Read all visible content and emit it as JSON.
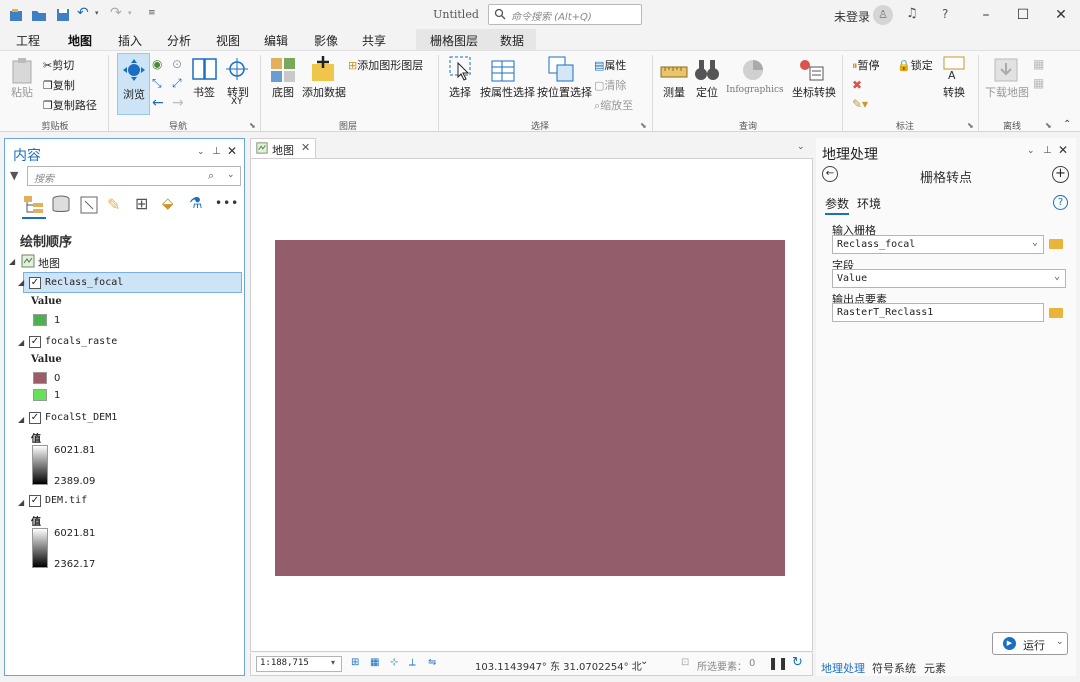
{
  "titlebar": {
    "doc_title": "Untitled",
    "search_placeholder": "命令搜索 (Alt+Q)",
    "signin": "未登录",
    "help": "?"
  },
  "tabs": [
    "工程",
    "地图",
    "插入",
    "分析",
    "视图",
    "编辑",
    "影像",
    "共享"
  ],
  "active_tab": "地图",
  "context_tabs": [
    "栅格图层",
    "数据"
  ],
  "ribbon": {
    "clipboard": {
      "paste": "粘贴",
      "cut": "剪切",
      "copy": "复制",
      "copy_path": "复制路径",
      "group": "剪贴板"
    },
    "navigate": {
      "explore": "浏览",
      "bookmarks": "书签",
      "goto": "转到",
      "goto_sub": "XY",
      "group": "导航"
    },
    "layer": {
      "basemap": "底图",
      "add_data": "添加数据",
      "add_graphics": "添加图形图层",
      "group": "图层"
    },
    "selection": {
      "select": "选择",
      "by_attr": "按属性选择",
      "by_location": "按位置选择",
      "attributes": "属性",
      "clear": "清除",
      "zoom_to": "缩放至",
      "group": "选择"
    },
    "inquiry": {
      "measure": "测量",
      "locate": "定位",
      "infographics": "Infographics",
      "coord_convert": "坐标转换",
      "group": "查询"
    },
    "labeling": {
      "pause": "暂停",
      "lock": "锁定",
      "convert": "转换",
      "group": "标注"
    },
    "offline": {
      "download_map": "下载地图",
      "group": "离线"
    }
  },
  "contents": {
    "title": "内容",
    "search_placeholder": "搜索",
    "drawing_order": "绘制顺序",
    "map_name": "地图",
    "layers": [
      {
        "name": "Reclass_focal",
        "legend_head": "Value",
        "entries": [
          {
            "label": "1",
            "color": "#4caf50"
          }
        ]
      },
      {
        "name": "focals_raste",
        "legend_head": "Value",
        "entries": [
          {
            "label": "0",
            "color": "#9e5c6a"
          },
          {
            "label": "1",
            "color": "#66e05a"
          }
        ]
      },
      {
        "name": "FocalSt_DEM1",
        "legend_head": "值",
        "high": "6021.81",
        "low": "2389.09"
      },
      {
        "name": "DEM.tif",
        "legend_head": "值",
        "high": "6021.81",
        "low": "2362.17"
      }
    ]
  },
  "map_view": {
    "tab_label": "地图",
    "raster_color": "#945d6b",
    "scale": "1:188,715",
    "coords": "103.1143947° 东 31.0702254° 北",
    "selected_label": "所选要素：",
    "selected_count": "0"
  },
  "geoprocessing": {
    "title": "地理处理",
    "tool_name": "栅格转点",
    "tabs": [
      "参数",
      "环境"
    ],
    "params": [
      {
        "label": "输入栅格",
        "value": "Reclass_focal"
      },
      {
        "label": "字段",
        "value": "Value"
      },
      {
        "label": "输出点要素",
        "value": "RasterT_Reclass1"
      }
    ],
    "run_label": "运行",
    "bottom_tabs": [
      "地理处理",
      "符号系统",
      "元素"
    ]
  }
}
